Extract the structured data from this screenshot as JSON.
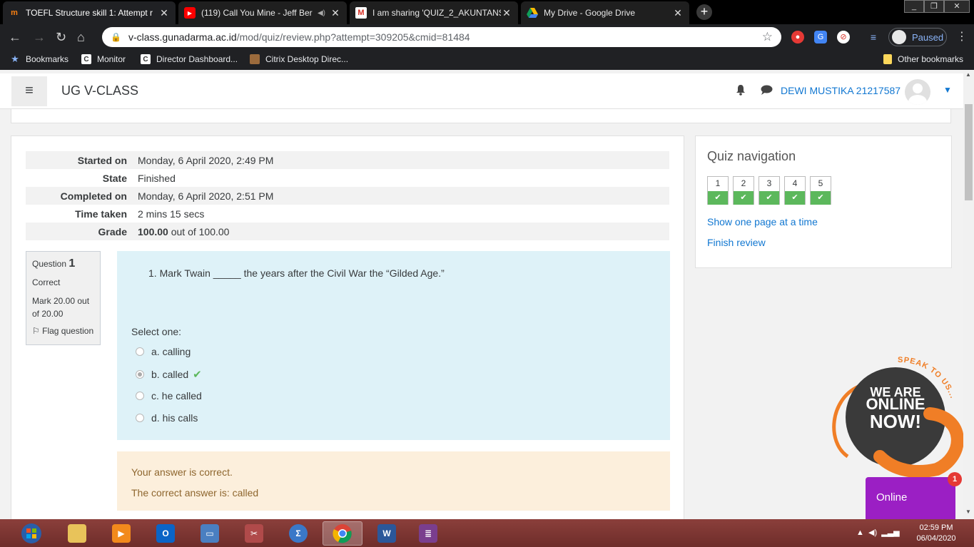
{
  "browser": {
    "tabs": [
      {
        "title": "TOEFL Structure skill 1: Attempt r",
        "icon": "moodle-icon"
      },
      {
        "title": "(119) Call You Mine - Jeff Ber",
        "icon": "youtube-icon"
      },
      {
        "title": "I am sharing 'QUIZ_2_AKUNTANS",
        "icon": "gmail-icon"
      },
      {
        "title": "My Drive - Google Drive",
        "icon": "google-drive-icon"
      }
    ],
    "url_host": "v-class.gunadarma.ac.id",
    "url_path": "/mod/quiz/review.php?attempt=309205&cmid=81484",
    "profile_label": "Paused",
    "bookmarks": [
      "Bookmarks",
      "Monitor",
      "Director Dashboard...",
      "Citrix Desktop Direc..."
    ],
    "other_bookmarks": "Other bookmarks"
  },
  "site": {
    "brand": "UG V-CLASS",
    "user_name": "DEWI MUSTIKA 21217587"
  },
  "summary": {
    "rows": [
      {
        "label": "Started on",
        "value": "Monday, 6 April 2020, 2:49 PM"
      },
      {
        "label": "State",
        "value": "Finished"
      },
      {
        "label": "Completed on",
        "value": "Monday, 6 April 2020, 2:51 PM"
      },
      {
        "label": "Time taken",
        "value": "2 mins 15 secs"
      }
    ],
    "grade_label": "Grade",
    "grade_value": "100.00",
    "grade_rest": "out of 100.00"
  },
  "question": {
    "label": "Question",
    "number": "1",
    "status": "Correct",
    "mark": "Mark 20.00 out of 20.00",
    "flag": "Flag question",
    "text": "1. Mark Twain _____ the years after the Civil War the “Gilded Age.”",
    "select_label": "Select one:",
    "options": [
      "a. calling",
      "b. called",
      "c. he called",
      "d. his calls"
    ],
    "selected_index": 1
  },
  "feedback": {
    "line1": "Your answer is correct.",
    "line2": "The correct answer is: called"
  },
  "quiz_nav": {
    "title": "Quiz navigation",
    "buttons": [
      "1",
      "2",
      "3",
      "4",
      "5"
    ],
    "show_one_page": "Show one page at a time",
    "finish_review": "Finish review"
  },
  "chat_widget": {
    "speak": "SPEAK TO US...",
    "we_are": "WE ARE",
    "online": "ONLINE",
    "now": "NOW!",
    "button": "Online",
    "badge": "1"
  },
  "taskbar": {
    "time": "02:59 PM",
    "date": "06/04/2020"
  }
}
